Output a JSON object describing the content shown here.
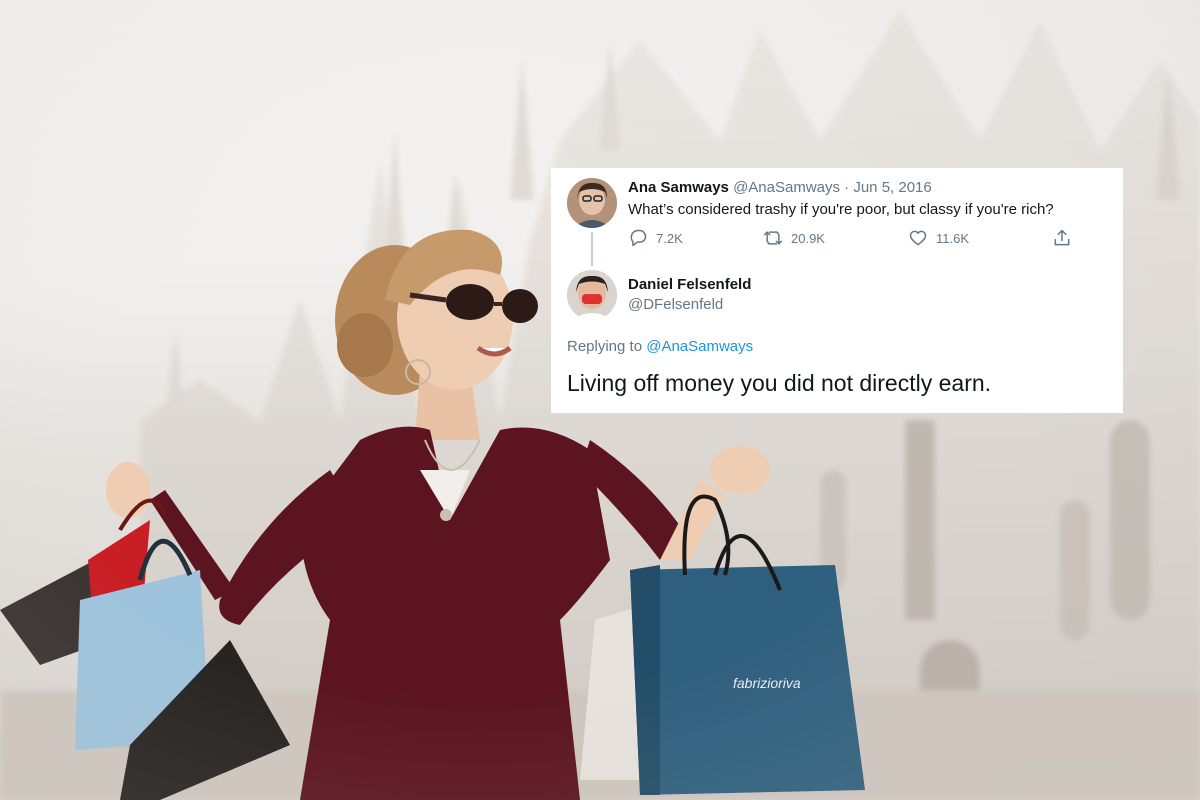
{
  "tweet": {
    "original": {
      "name": "Ana Samways",
      "handle": "@AnaSamways",
      "date": "Jun 5, 2016",
      "separator": " · ",
      "text": "What’s considered trashy if you're poor, but classy if you're rich?",
      "reply_count": "7.2K",
      "retweet_count": "20.9K",
      "like_count": "11.6K"
    },
    "reply": {
      "name": "Daniel Felsenfeld",
      "handle": "@DFelsenfeld",
      "replying_prefix": "Replying to ",
      "replying_to": "@AnaSamways",
      "text": "Living off money you did not directly earn."
    }
  },
  "colors": {
    "link": "#1b95e0",
    "muted": "#657786",
    "dress": "#5b1420",
    "shopping_bag_blue": "#2e5f7e"
  },
  "photo": {
    "bag_logo": "fabrizioriva"
  }
}
